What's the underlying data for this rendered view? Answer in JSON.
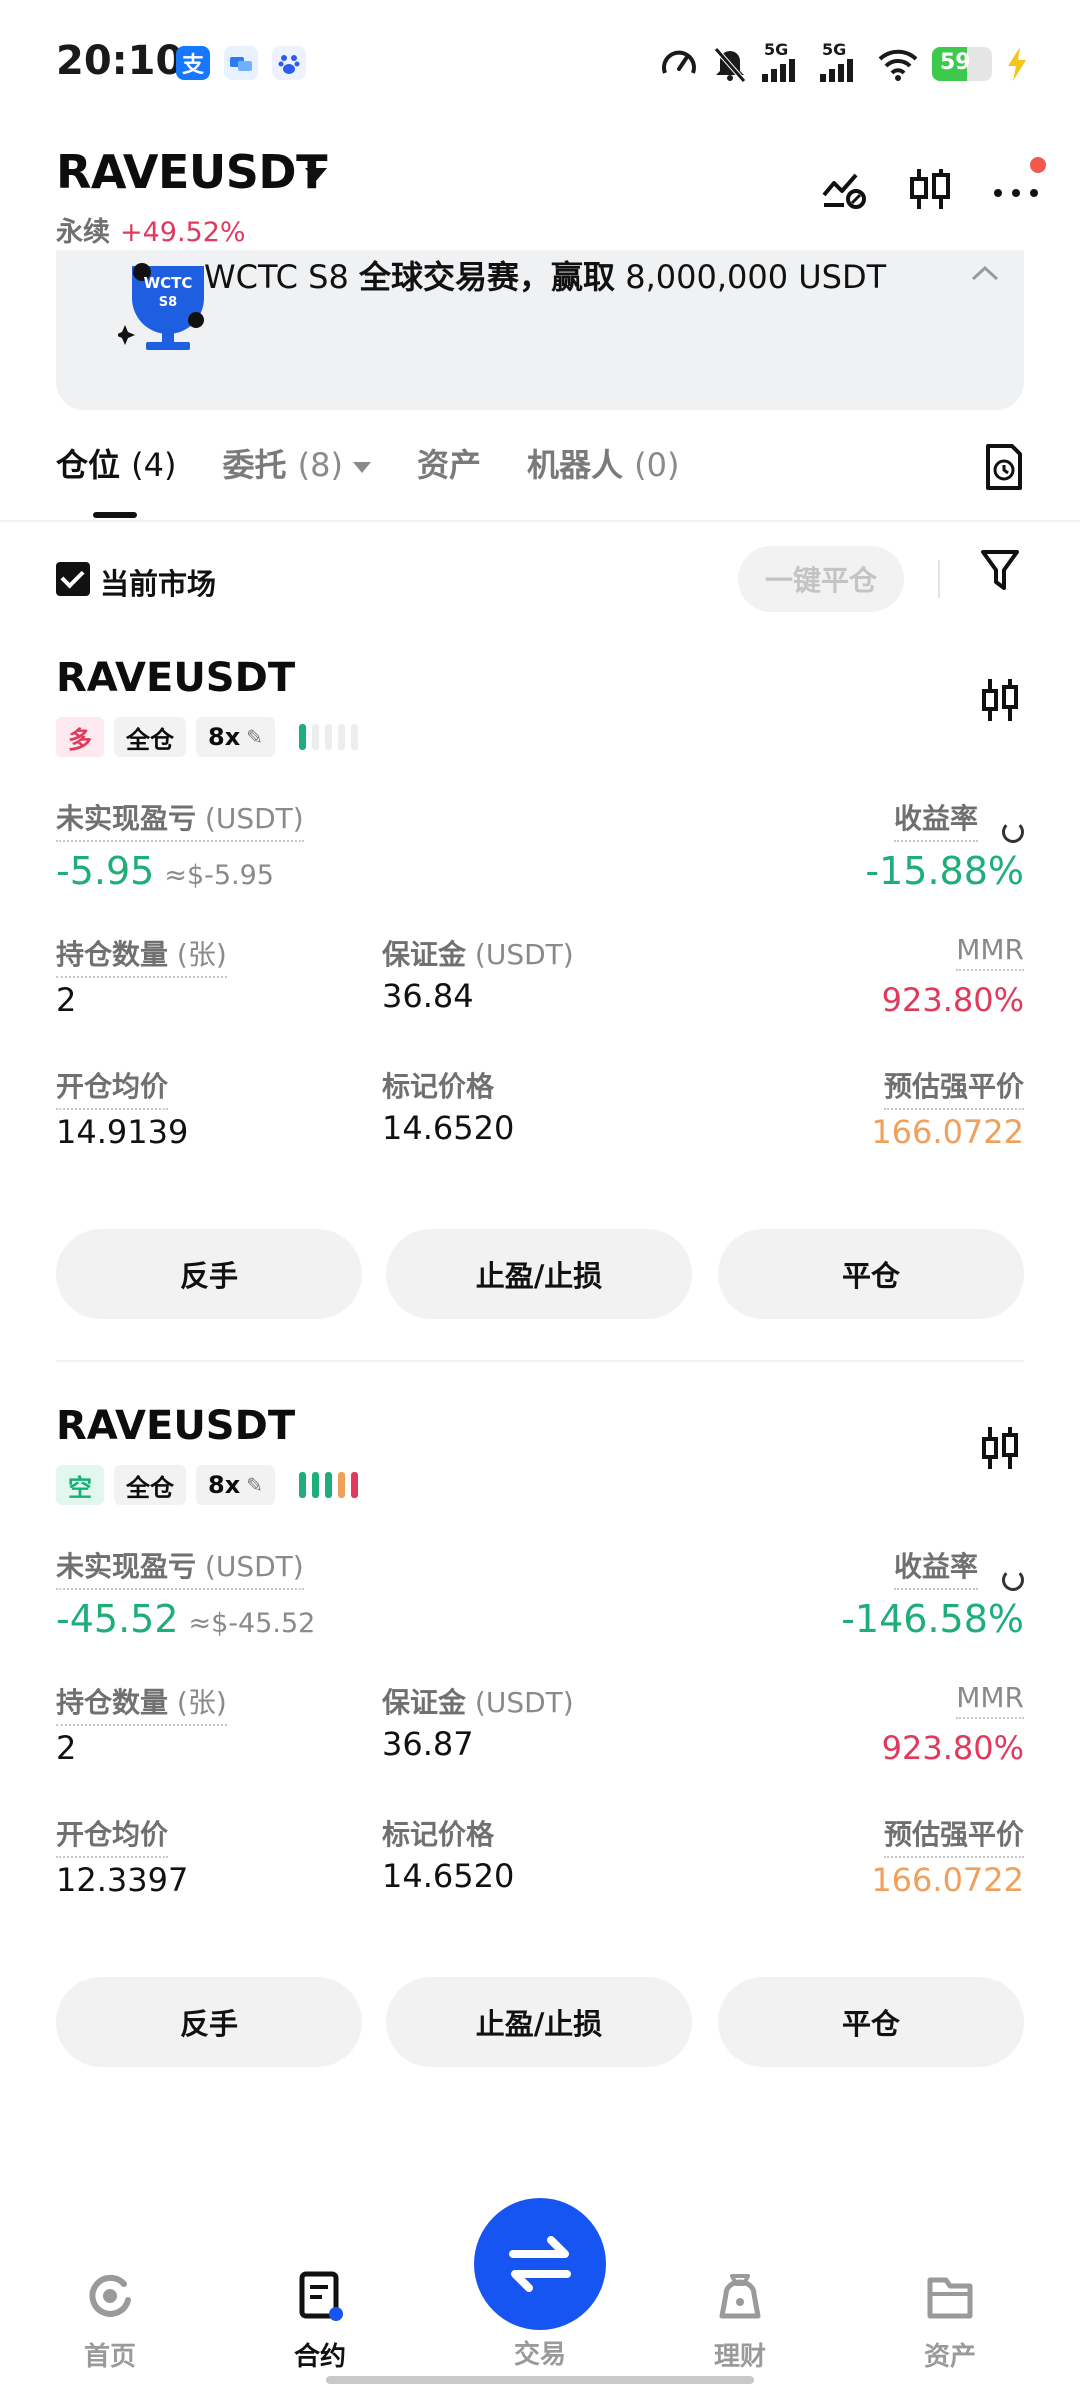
{
  "status_bar": {
    "time": "20:10",
    "network_1": "5G",
    "network_2": "5G",
    "battery": "59"
  },
  "header": {
    "symbol": "RAVEUSDT",
    "contract_type": "永续",
    "change": "+49.52%"
  },
  "banner": {
    "logo_text_1": "WCTC",
    "logo_text_2": "S8",
    "text_prefix": "WCTC S8 ",
    "text_bold": "全球交易赛，赢取",
    "text_suffix": " 8,000,000 USDT",
    "close": "×"
  },
  "tabs": [
    {
      "label": "仓位",
      "count": "(4)"
    },
    {
      "label": "委托",
      "count": "(8)"
    },
    {
      "label": "资产",
      "count": ""
    },
    {
      "label": "机器人",
      "count": "(0)"
    }
  ],
  "filter": {
    "current_market": "当前市场",
    "close_all": "一键平仓"
  },
  "positions": [
    {
      "symbol": "RAVEUSDT",
      "side": "多",
      "margin_mode": "全仓",
      "leverage": "8x",
      "adl_level": 1,
      "unrealized_label": "未实现盈亏",
      "unrealized_unit": "(USDT)",
      "unrealized_pnl": "-5.95",
      "unrealized_usd": "≈$-5.95",
      "roe_label": "收益率",
      "roe": "-15.88%",
      "qty_label": "持仓数量",
      "qty_unit": "(张)",
      "qty": "2",
      "margin_label": "保证金",
      "margin_unit": "(USDT)",
      "margin": "36.84",
      "mmr_label": "MMR",
      "mmr": "923.80%",
      "entry_label": "开仓均价",
      "entry_price": "14.9139",
      "mark_label": "标记价格",
      "mark_price": "14.6520",
      "liq_label": "预估强平价",
      "liq_price": "166.0722",
      "btn_reverse": "反手",
      "btn_tpsl": "止盈/止损",
      "btn_close": "平仓"
    },
    {
      "symbol": "RAVEUSDT",
      "side": "空",
      "margin_mode": "全仓",
      "leverage": "8x",
      "adl_level": 5,
      "unrealized_label": "未实现盈亏",
      "unrealized_unit": "(USDT)",
      "unrealized_pnl": "-45.52",
      "unrealized_usd": "≈$-45.52",
      "roe_label": "收益率",
      "roe": "-146.58%",
      "qty_label": "持仓数量",
      "qty_unit": "(张)",
      "qty": "2",
      "margin_label": "保证金",
      "margin_unit": "(USDT)",
      "margin": "36.87",
      "mmr_label": "MMR",
      "mmr": "923.80%",
      "entry_label": "开仓均价",
      "entry_price": "12.3397",
      "mark_label": "标记价格",
      "mark_price": "14.6520",
      "liq_label": "预估强平价",
      "liq_price": "166.0722",
      "btn_reverse": "反手",
      "btn_tpsl": "止盈/止损",
      "btn_close": "平仓"
    }
  ],
  "bottom_nav": [
    {
      "label": "首页",
      "icon": "home-icon"
    },
    {
      "label": "合约",
      "icon": "contract-icon"
    },
    {
      "label": "交易",
      "icon": "swap-icon"
    },
    {
      "label": "理财",
      "icon": "finance-icon"
    },
    {
      "label": "资产",
      "icon": "wallet-icon"
    }
  ],
  "colors": {
    "up_green": "#1fae7a",
    "down_red": "#e0395c",
    "liq_orange": "#f0a05a",
    "brand_blue": "#1655f2"
  }
}
